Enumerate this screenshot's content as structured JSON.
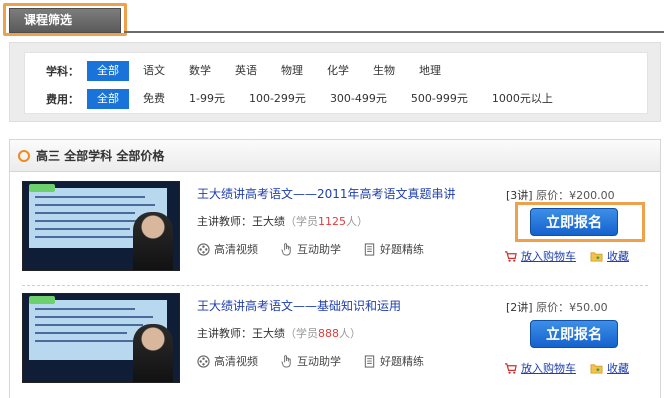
{
  "tab": {
    "label": "课程筛选"
  },
  "filters": {
    "subject": {
      "label": "学科：",
      "options": [
        "全部",
        "语文",
        "数学",
        "英语",
        "物理",
        "化学",
        "生物",
        "地理"
      ]
    },
    "fee": {
      "label": "费用：",
      "options": [
        "全部",
        "免费",
        "1-99元",
        "100-299元",
        "300-499元",
        "500-999元",
        "1000元以上"
      ]
    }
  },
  "results": {
    "heading": "高三  全部学科  全部价格",
    "courses": [
      {
        "title": "王大绩讲高考语文——2011年高考语文真题串讲",
        "teacher_label": "主讲教师：王大绩",
        "students_prefix": "（学员",
        "students_count": "1125",
        "students_suffix": "人）",
        "features": [
          "高清视频",
          "互动助学",
          "好题精练"
        ],
        "lectures": "[3讲]",
        "price": "原价：¥200.00",
        "enroll": "立即报名",
        "cart": "放入购物车",
        "favorite": "收藏"
      },
      {
        "title": "王大绩讲高考语文——基础知识和运用",
        "teacher_label": "主讲教师：王大绩",
        "students_prefix": "（学员",
        "students_count": "888",
        "students_suffix": "人）",
        "features": [
          "高清视频",
          "互动助学",
          "好题精练"
        ],
        "lectures": "[2讲]",
        "price": "原价：¥50.00",
        "enroll": "立即报名",
        "cart": "放入购物车",
        "favorite": "收藏"
      }
    ]
  },
  "colors": {
    "accent": "#1a73d8",
    "highlight": "#f0a04b",
    "link": "#1f3fae",
    "count": "#e03b3b"
  }
}
